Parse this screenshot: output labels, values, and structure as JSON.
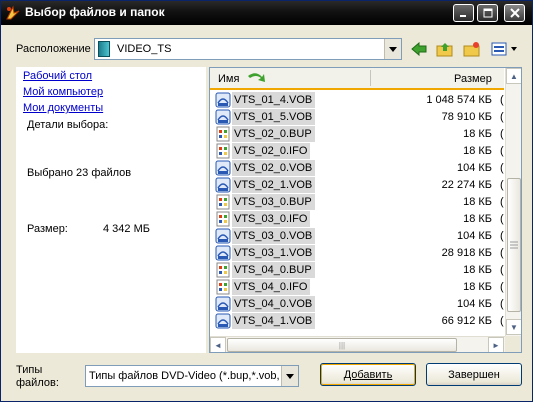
{
  "window": {
    "title": "Выбор файлов и папок"
  },
  "location": {
    "label": "Расположение",
    "value": "VIDEO_TS"
  },
  "left_pane": {
    "links": [
      "Рабочий стол",
      "Мой компьютер",
      "Мои документы"
    ],
    "details_title": "Детали выбора:",
    "selected_text": "Выбрано 23 файлов",
    "size_label": "Размер:",
    "size_value": "4 342 МБ"
  },
  "columns": {
    "name": "Имя",
    "size": "Размер"
  },
  "files": [
    {
      "name": "VTS_01_4.VOB",
      "size": "1 048 574 КБ",
      "type": "vob"
    },
    {
      "name": "VTS_01_5.VOB",
      "size": "78 910 КБ",
      "type": "vob"
    },
    {
      "name": "VTS_02_0.BUP",
      "size": "18 КБ",
      "type": "doc"
    },
    {
      "name": "VTS_02_0.IFO",
      "size": "18 КБ",
      "type": "doc"
    },
    {
      "name": "VTS_02_0.VOB",
      "size": "104 КБ",
      "type": "vob"
    },
    {
      "name": "VTS_02_1.VOB",
      "size": "22 274 КБ",
      "type": "vob"
    },
    {
      "name": "VTS_03_0.BUP",
      "size": "18 КБ",
      "type": "doc"
    },
    {
      "name": "VTS_03_0.IFO",
      "size": "18 КБ",
      "type": "doc"
    },
    {
      "name": "VTS_03_0.VOB",
      "size": "104 КБ",
      "type": "vob"
    },
    {
      "name": "VTS_03_1.VOB",
      "size": "28 918 КБ",
      "type": "vob"
    },
    {
      "name": "VTS_04_0.BUP",
      "size": "18 КБ",
      "type": "doc"
    },
    {
      "name": "VTS_04_0.IFO",
      "size": "18 КБ",
      "type": "doc"
    },
    {
      "name": "VTS_04_0.VOB",
      "size": "104 КБ",
      "type": "vob"
    },
    {
      "name": "VTS_04_1.VOB",
      "size": "66 912 КБ",
      "type": "vob"
    }
  ],
  "file_types": {
    "label_line1": "Типы",
    "label_line2": "файлов:",
    "value": "Типы файлов DVD-Video (*.bup,*.vob,*.ifo)"
  },
  "buttons": {
    "add": "Добавить",
    "done": "Завершен"
  },
  "accent_color": "#f0a800"
}
